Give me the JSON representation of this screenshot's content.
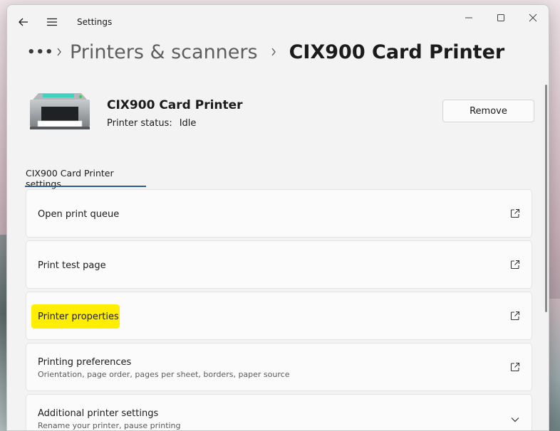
{
  "window": {
    "app_title": "Settings"
  },
  "breadcrumb": {
    "more": "•••",
    "parent": "Printers & scanners",
    "current": "CIX900 Card Printer"
  },
  "printer": {
    "name": "CIX900 Card Printer",
    "status_label": "Printer status:",
    "status_value": "Idle",
    "remove_label": "Remove"
  },
  "section": {
    "title": "CIX900 Card Printer settings"
  },
  "settings_items": [
    {
      "title": "Open print queue",
      "subtitle": "",
      "icon": "open-external-icon"
    },
    {
      "title": "Print test page",
      "subtitle": "",
      "icon": "open-external-icon"
    },
    {
      "title": "Printer properties",
      "subtitle": "",
      "icon": "open-external-icon",
      "highlighted": true
    },
    {
      "title": "Printing preferences",
      "subtitle": "Orientation, page order, pages per sheet, borders, paper source",
      "icon": "open-external-icon"
    },
    {
      "title": "Additional printer settings",
      "subtitle": "Rename your printer, pause printing",
      "icon": "chevron-down-icon"
    }
  ],
  "colors": {
    "accent_underline": "#2d5b8a",
    "highlight": "#ffee00",
    "window_bg": "#f3f3f3",
    "card_bg": "#fbfbfb"
  }
}
